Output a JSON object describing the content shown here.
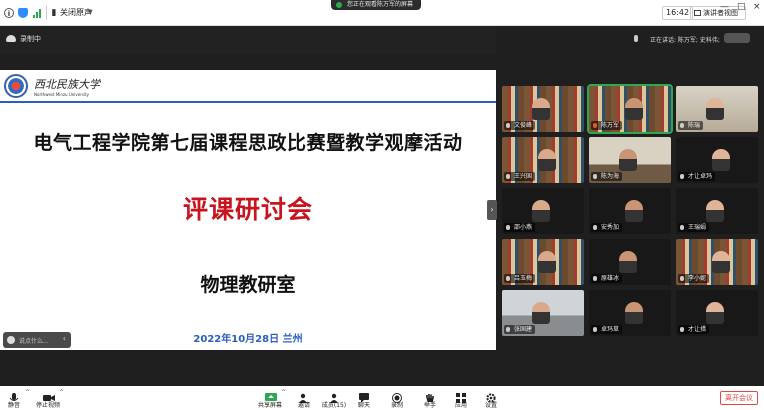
{
  "topbar": {
    "mute_label": "关闭原声",
    "clock": "16:42",
    "view_label": "演讲者视图",
    "share_banner": "您正在观看陈万军的屏幕"
  },
  "status": {
    "recording_label": "录制中"
  },
  "slide": {
    "university_cn": "西北民族大学",
    "university_en": "Northwest Minzu University",
    "title": "电气工程学院第七届课程思政比赛暨教学观摩活动",
    "subtitle": "评课研讨会",
    "department": "物理教研室",
    "date_place": "2022年10月28日  兰州",
    "colors": {
      "title": "#111111",
      "subtitle": "#c8141e",
      "date": "#2b5ebd",
      "rule": "#2b5ebd"
    }
  },
  "chat_popup": {
    "placeholder": "说点什么..."
  },
  "speaking": {
    "label": "正在讲话: 陈万军; 史科伟;"
  },
  "participants": [
    {
      "name": "文俊峰",
      "scene": "shelf",
      "active": false,
      "mic_hot": false
    },
    {
      "name": "陈万军",
      "scene": "shelf",
      "active": true,
      "mic_hot": true
    },
    {
      "name": "陈瑞",
      "scene": "wall",
      "active": false,
      "mic_hot": false
    },
    {
      "name": "王兴国",
      "scene": "shelf",
      "active": false,
      "mic_hot": false
    },
    {
      "name": "陈为海",
      "scene": "room",
      "active": false,
      "mic_hot": false
    },
    {
      "name": "才让卓玛",
      "scene": "dark",
      "active": false,
      "mic_hot": false
    },
    {
      "name": "邵小燕",
      "scene": "dark",
      "active": false,
      "mic_hot": false
    },
    {
      "name": "安秀加",
      "scene": "dark",
      "active": false,
      "mic_hot": false
    },
    {
      "name": "王瑞娟",
      "scene": "dark",
      "active": false,
      "mic_hot": false
    },
    {
      "name": "吕玉梅",
      "scene": "shelf",
      "active": false,
      "mic_hot": false
    },
    {
      "name": "原雄冰",
      "scene": "dark",
      "active": false,
      "mic_hot": false
    },
    {
      "name": "李小妮",
      "scene": "shelf",
      "active": false,
      "mic_hot": false
    },
    {
      "name": "张国建",
      "scene": "office",
      "active": false,
      "mic_hot": false
    },
    {
      "name": "卓玛草",
      "scene": "dark",
      "active": false,
      "mic_hot": false
    },
    {
      "name": "才让措",
      "scene": "dark",
      "active": false,
      "mic_hot": false
    }
  ],
  "toolbar": {
    "mute": "静音",
    "stop_video": "停止视频",
    "share_screen": "共享屏幕",
    "invite": "邀请",
    "participants": "成员(15)",
    "chat": "聊天",
    "record": "录制",
    "raise_hand": "举手",
    "apps": "应用",
    "settings": "设置",
    "leave": "离开会议"
  }
}
